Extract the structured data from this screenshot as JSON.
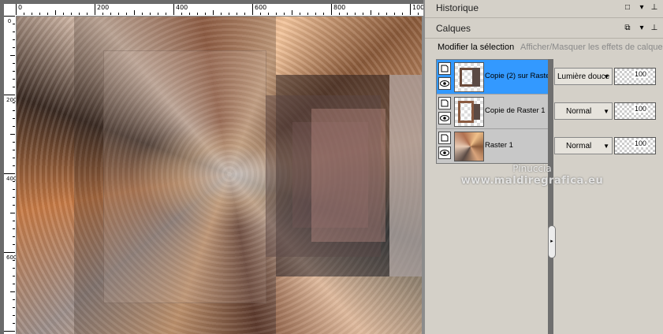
{
  "ruler": {
    "h_labels": [
      "0",
      "200",
      "400",
      "600",
      "800",
      "100"
    ],
    "v_labels": [
      "0",
      "200",
      "400",
      "600"
    ]
  },
  "panels": {
    "history_title": "Historique",
    "layers_title": "Calques"
  },
  "toolbar": {
    "modify_selection": "Modifier la sélection",
    "show_hide_effects": "Afficher/Masquer les effets de calque"
  },
  "layers": [
    {
      "name": "Copie (2) sur Raster",
      "blend": "Lumière douce",
      "opacity": "100",
      "selected": true
    },
    {
      "name": "Copie de Raster 1",
      "blend": "Normal",
      "opacity": "100",
      "selected": false
    },
    {
      "name": "Raster 1",
      "blend": "Normal",
      "opacity": "100",
      "selected": false
    }
  ],
  "watermark": {
    "line1": "Pinuccia",
    "line2": "www.maldiregrafica.eu"
  },
  "colors": {
    "selected_row": "#3399ff",
    "panel_bg": "#d4d0c8",
    "divider": "#6f6f6f"
  }
}
